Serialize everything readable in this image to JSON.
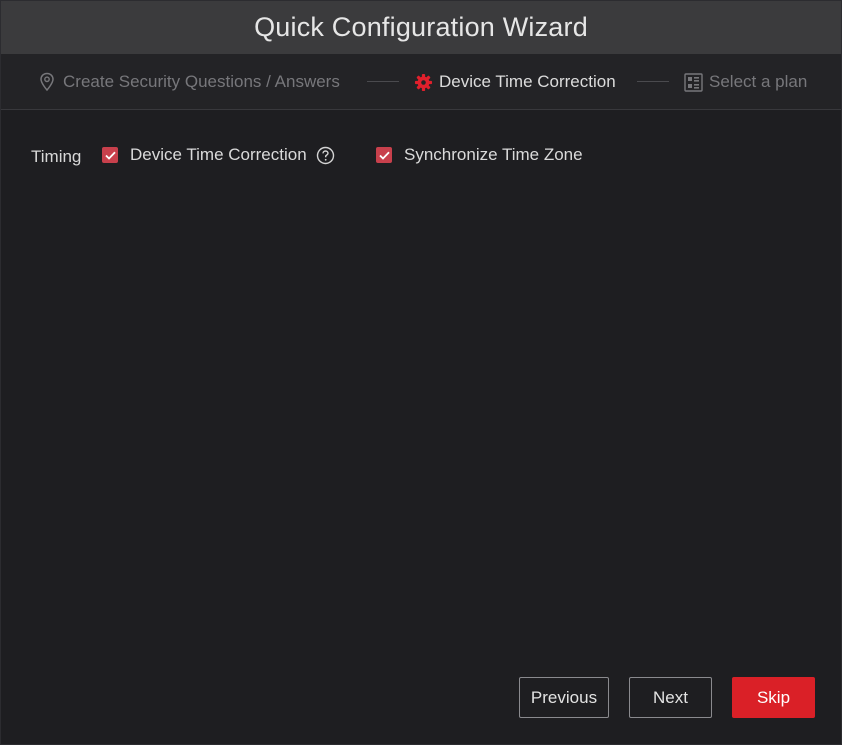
{
  "window": {
    "title": "Quick Configuration Wizard"
  },
  "steps": [
    {
      "label": "Create Security Questions / Answers",
      "icon": "location-pin-icon",
      "state": "inactive"
    },
    {
      "label": "Device Time Correction",
      "icon": "gear-icon",
      "state": "active"
    },
    {
      "label": "Select a plan",
      "icon": "plan-grid-icon",
      "state": "inactive"
    }
  ],
  "timing": {
    "label": "Timing",
    "options": [
      {
        "label": "Device Time Correction",
        "checked": true,
        "has_help": true
      },
      {
        "label": "Synchronize Time Zone",
        "checked": true,
        "has_help": false
      }
    ]
  },
  "buttons": {
    "previous": "Previous",
    "next": "Next",
    "skip": "Skip"
  },
  "colors": {
    "accent": "#da2027",
    "checkbox": "#c8404c",
    "titlebar": "#3b3b3d",
    "background": "#1e1e21"
  }
}
